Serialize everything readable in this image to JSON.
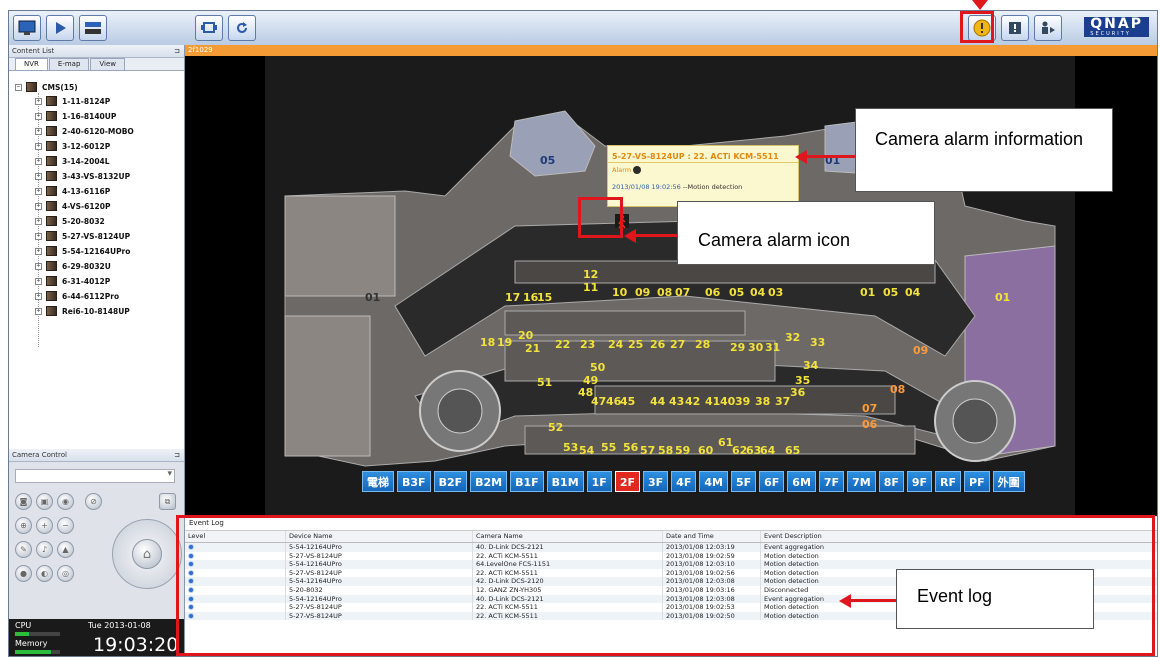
{
  "toolbar": {
    "icons": [
      "monitor-icon",
      "play-icon",
      "playback-server-icon",
      "sequence-icon",
      "refresh-icon",
      "alarm-icon",
      "message-icon",
      "logout-icon"
    ],
    "brand": "QNAP",
    "brand_sub": "SECURITY"
  },
  "content_list": {
    "title": "Content List",
    "tabs": [
      "NVR",
      "E-map",
      "View"
    ],
    "root": "CMS(15)",
    "items": [
      "1-11-8124P",
      "1-16-8140UP",
      "2-40-6120-MOBO",
      "3-12-6012P",
      "3-14-2004L",
      "3-43-VS-8132UP",
      "4-13-6116P",
      "4-VS-6120P",
      "5-20-8032",
      "5-27-VS-8124UP",
      "5-54-12164UPro",
      "6-29-8032U",
      "6-31-4012P",
      "6-44-6112Pro",
      "Rei6-10-8148UP"
    ]
  },
  "camera_control": {
    "title": "Camera Control"
  },
  "status": {
    "cpu_label": "CPU",
    "memory_label": "Memory",
    "date": "Tue 2013-01-08",
    "time": "19:03:20",
    "cpu_level": 0.3,
    "memory_level": 0.8
  },
  "main": {
    "title": "2f1029"
  },
  "map": {
    "labels": [
      "05",
      "04",
      "03",
      "01",
      "12",
      "11",
      "10",
      "09",
      "08",
      "07",
      "06",
      "05",
      "04",
      "03",
      "01",
      "05",
      "04",
      "01",
      "17",
      "16",
      "15",
      "14",
      "18",
      "19",
      "20",
      "21",
      "22",
      "23",
      "24",
      "25",
      "26",
      "27",
      "28",
      "29",
      "30",
      "31",
      "32",
      "33",
      "34",
      "35",
      "36",
      "37",
      "38",
      "39",
      "40",
      "41",
      "42",
      "43",
      "44",
      "45",
      "46",
      "47",
      "48",
      "49",
      "50",
      "51",
      "52",
      "53",
      "54",
      "55",
      "56",
      "57",
      "58",
      "59",
      "60",
      "61",
      "62",
      "63",
      "64",
      "65",
      "06",
      "07",
      "08",
      "09",
      "01"
    ],
    "floors": [
      "電梯",
      "B3F",
      "B2F",
      "B2M",
      "B1F",
      "B1M",
      "1F",
      "2F",
      "3F",
      "4F",
      "4M",
      "5F",
      "6F",
      "6M",
      "7F",
      "7M",
      "8F",
      "9F",
      "RF",
      "PF",
      "外圍"
    ],
    "active_floor": "2F"
  },
  "popup": {
    "title": "5-27-VS-8124UP : 22. ACTi KCM-5511",
    "alarm_label": "Alarm",
    "time": "2013/01/08 19:02:56",
    "message": "--Motion detection"
  },
  "event_log": {
    "title": "Event Log",
    "columns": [
      "Level",
      "Device Name",
      "Camera Name",
      "Date and Time",
      "Event Description"
    ],
    "rows": [
      [
        "5-54-12164UPro",
        "40. D-Link DCS-2121",
        "2013/01/08 12:03:19",
        "Event aggregation"
      ],
      [
        "5-27-VS-8124UP",
        "22. ACTi KCM-5511",
        "2013/01/08 19:02:59",
        "Motion detection"
      ],
      [
        "5-54-12164UPro",
        "64.LevelOne FCS-1151",
        "2013/01/08 12:03:10",
        "Motion detection"
      ],
      [
        "5-27-VS-8124UP",
        "22. ACTi KCM-5511",
        "2013/01/08 19:02:56",
        "Motion detection"
      ],
      [
        "5-54-12164UPro",
        "42. D-Link DCS-2120",
        "2013/01/08 12:03:08",
        "Motion detection"
      ],
      [
        "5-20-8032",
        "12. GANZ ZN-YH305",
        "2013/01/08 19:03:16",
        "Disconnected"
      ],
      [
        "5-54-12164UPro",
        "40. D-Link DCS-2121",
        "2013/01/08 12:03:08",
        "Event aggregation"
      ],
      [
        "5-27-VS-8124UP",
        "22. ACTi KCM-5511",
        "2013/01/08 19:02:53",
        "Motion detection"
      ],
      [
        "5-27-VS-8124UP",
        "22. ACTi KCM-5511",
        "2013/01/08 19:02:50",
        "Motion detection"
      ]
    ]
  },
  "annotations": {
    "alarm_info": "Camera alarm information",
    "alarm_icon": "Camera alarm icon",
    "event_log": "Event log",
    "color": "#e0161d"
  }
}
